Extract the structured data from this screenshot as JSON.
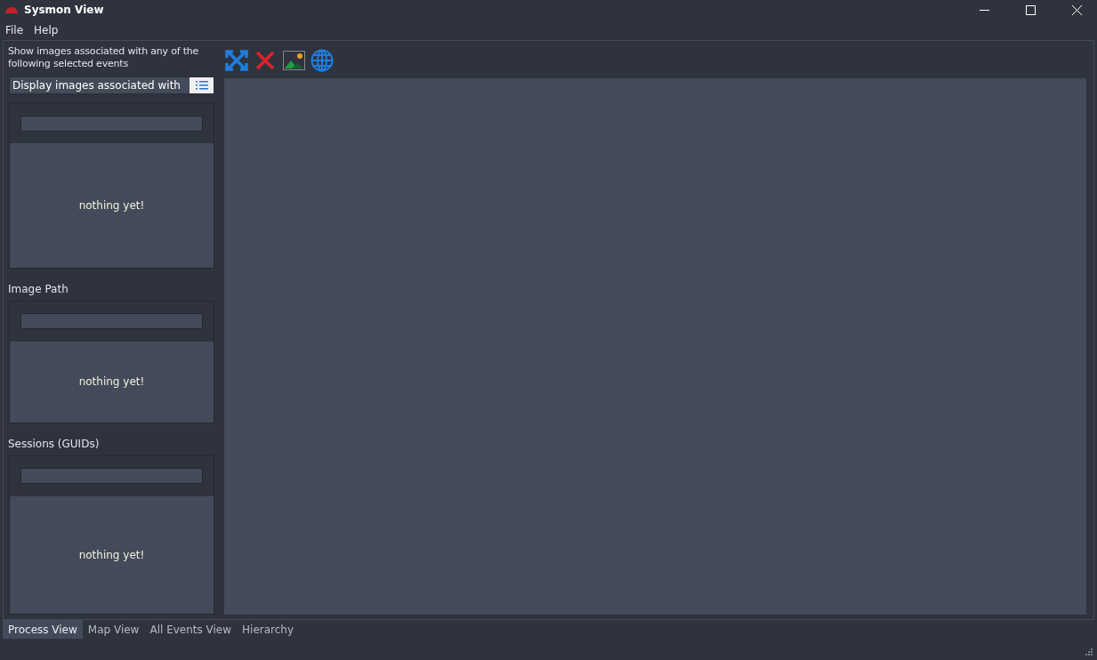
{
  "window": {
    "title": "Sysmon View"
  },
  "menu": [
    "File",
    "Help"
  ],
  "sidebar": {
    "description": "Show images associated with any of the following selected events",
    "filter": {
      "value": "Display images associated with"
    },
    "sections": [
      {
        "empty_text": "nothing yet!"
      },
      {
        "label": "Image Path",
        "empty_text": "nothing yet!"
      },
      {
        "label": "Sessions (GUIDs)",
        "empty_text": "nothing yet!"
      }
    ]
  },
  "tabs": [
    {
      "label": "Process View",
      "selected": true
    },
    {
      "label": "Map View",
      "selected": false
    },
    {
      "label": "All Events View",
      "selected": false
    },
    {
      "label": "Hierarchy",
      "selected": false
    }
  ]
}
